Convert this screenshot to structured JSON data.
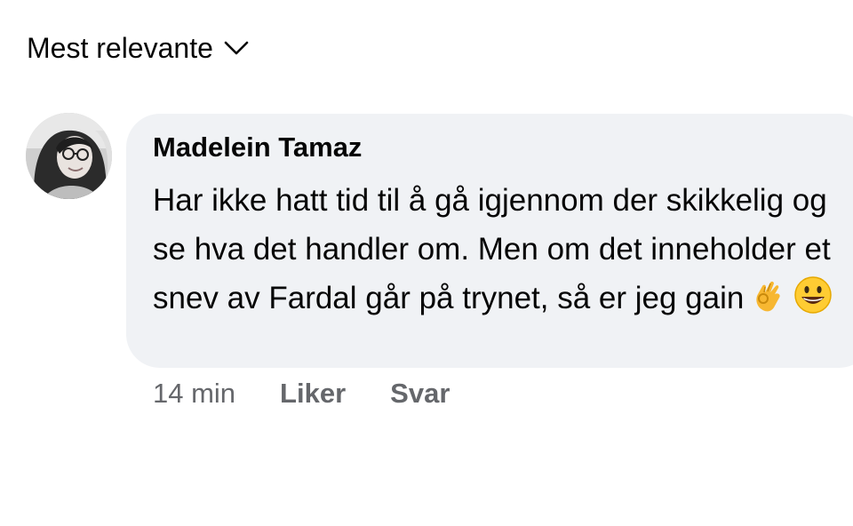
{
  "sort": {
    "label": "Mest relevante",
    "icon": "chevron-down-icon"
  },
  "comment": {
    "author": "Madelein Tamaz",
    "text": "Har ikke hatt tid til å gå igjennom der skikkelig og se hva det handler om. Men om det inneholder et snev av Fardal går på trynet, så er jeg gain",
    "emojis": [
      "ok-hand-emoji",
      "grinning-face-emoji"
    ],
    "avatar_icon": "profile-avatar",
    "bubble_color": "#f0f2f5",
    "meta": {
      "time": "14 min",
      "like_label": "Liker",
      "reply_label": "Svar"
    }
  },
  "colors": {
    "text_primary": "#050505",
    "text_secondary": "#65676b"
  }
}
